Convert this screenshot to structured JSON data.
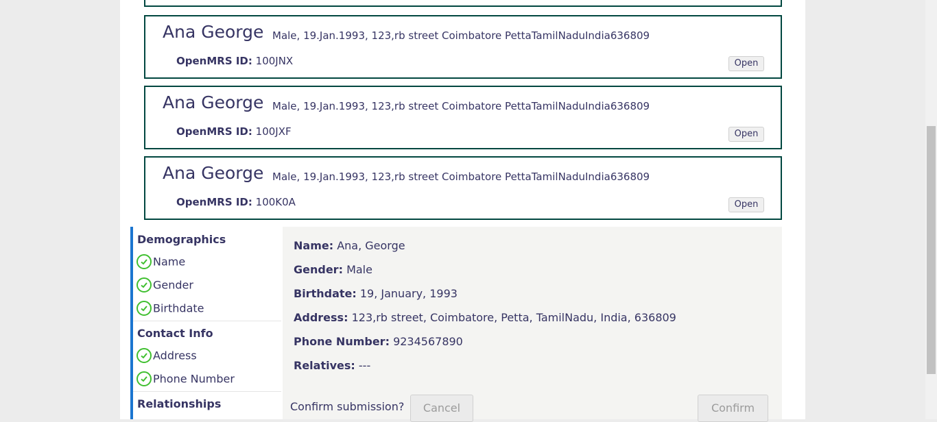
{
  "patients": [
    {
      "name": "Ana George",
      "details": "Male, 19.Jan.1993, 123,rb street Coimbatore PettaTamilNaduIndia636809",
      "id_label": "OpenMRS ID:",
      "id_value": "100JNX",
      "open_label": "Open"
    },
    {
      "name": "Ana George",
      "details": "Male, 19.Jan.1993, 123,rb street Coimbatore PettaTamilNaduIndia636809",
      "id_label": "OpenMRS ID:",
      "id_value": "100JXF",
      "open_label": "Open"
    },
    {
      "name": "Ana George",
      "details": "Male, 19.Jan.1993, 123,rb street Coimbatore PettaTamilNaduIndia636809",
      "id_label": "OpenMRS ID:",
      "id_value": "100K0A",
      "open_label": "Open"
    }
  ],
  "sidebar": {
    "demographics": {
      "title": "Demographics",
      "items": [
        "Name",
        "Gender",
        "Birthdate"
      ]
    },
    "contact": {
      "title": "Contact Info",
      "items": [
        "Address",
        "Phone Number"
      ]
    },
    "relationships": {
      "title": "Relationships"
    }
  },
  "summary": {
    "name": {
      "label": "Name:",
      "value": "Ana, George"
    },
    "gender": {
      "label": "Gender:",
      "value": "Male"
    },
    "birthdate": {
      "label": "Birthdate:",
      "value": "19, January, 1993"
    },
    "address": {
      "label": "Address:",
      "value": "123,rb street, Coimbatore, Petta, TamilNadu, India, 636809"
    },
    "phone": {
      "label": "Phone Number:",
      "value": "9234567890"
    },
    "relatives": {
      "label": "Relatives:",
      "value": "---"
    }
  },
  "confirm": {
    "question": "Confirm submission?",
    "cancel_label": "Cancel",
    "confirm_label": "Confirm"
  },
  "colors": {
    "accent_blue": "#1b75d0",
    "card_border": "#00463f",
    "check_green": "#3fbf2f",
    "text": "#363463"
  }
}
